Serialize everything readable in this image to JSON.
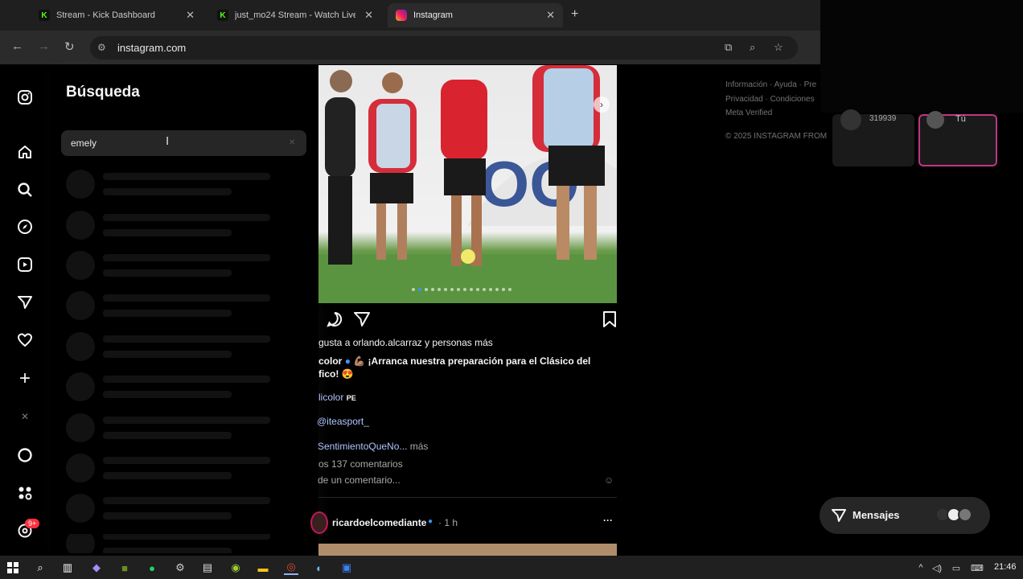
{
  "browser": {
    "tabs": [
      {
        "title": "Stream - Kick Dashboard",
        "icon": "kick-icon"
      },
      {
        "title": "just_mo24 Stream - Watch Live",
        "icon": "kick-icon"
      },
      {
        "title": "Instagram",
        "icon": "instagram-icon"
      }
    ],
    "url": "instagram.com"
  },
  "search": {
    "title": "Búsqueda",
    "query": "emely",
    "skeleton_rows": 10
  },
  "post": {
    "likes_text": "gusta a orlando.alcarraz y personas más",
    "caption_user": "color",
    "caption_text": "💪🏽 ¡Arranca nuestra preparación para el Clásico del",
    "caption_text2": "fico! 😍",
    "mention1": "licolor",
    "mention1_suffix": "PE",
    "mention2": "@iteasport_",
    "hashtag": "SentimientoQueNo...",
    "more": "más",
    "comments": "os 137 comentarios",
    "add_comment": "de un comentario..."
  },
  "post2": {
    "username": "ricardoelcomediante",
    "time": "1 h",
    "menu": "···"
  },
  "footer": {
    "line1": "Información · Ayuda · Pre",
    "line2": "Privacidad · Condiciones",
    "line3": "Meta Verified",
    "copyright": "© 2025 INSTAGRAM FROM"
  },
  "stories": {
    "card1_label": "319939",
    "card2_label": "Tú"
  },
  "messages": {
    "label": "Mensajes"
  },
  "notifications": {
    "badge": "9+"
  },
  "taskbar": {
    "time": "21:46"
  },
  "colors": {
    "accent": "#3897f0",
    "badge": "#ff3040",
    "story_ring": "#c13584"
  }
}
